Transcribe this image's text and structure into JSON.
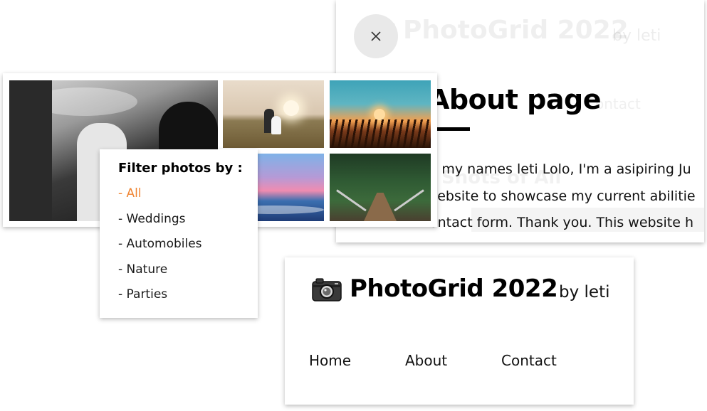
{
  "about_card": {
    "heading": "About page",
    "ghost_title": "PhotoGrid 2022",
    "ghost_by": "by leti",
    "ghost_contact": "Contact",
    "ghost_shots": "Shots of All",
    "text_lines": [
      "i, my names leti Lolo, I'm a asipiring Ju",
      "vebsite to showcase my current abilitie",
      "ontact form. Thank you. This website h"
    ]
  },
  "filter": {
    "heading": "Filter photos by :",
    "items": [
      {
        "label": "- All",
        "active": true
      },
      {
        "label": "- Weddings",
        "active": false
      },
      {
        "label": "- Automobiles",
        "active": false
      },
      {
        "label": "- Nature",
        "active": false
      },
      {
        "label": "- Parties",
        "active": false
      }
    ]
  },
  "header": {
    "title": "PhotoGrid 2022",
    "by": "by leti",
    "nav": {
      "home": "Home",
      "about": "About",
      "contact": "Contact"
    }
  },
  "colors": {
    "accent": "#f08533",
    "close_bg": "#e9e9e9"
  },
  "icons": {
    "close": "close-icon",
    "camera": "camera-icon"
  }
}
